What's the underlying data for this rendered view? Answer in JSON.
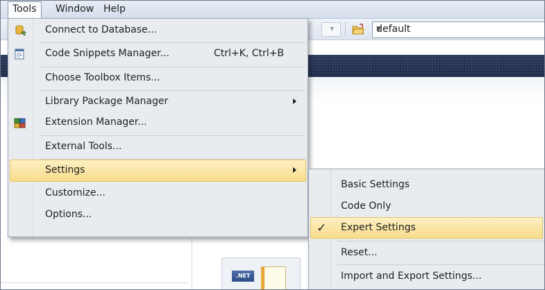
{
  "menubar": {
    "items": [
      {
        "label": "Tools"
      },
      {
        "label": "Window"
      },
      {
        "label": "Help"
      }
    ]
  },
  "toolbar": {
    "config_value": "default"
  },
  "tools_menu": {
    "items": [
      {
        "label": "Connect to Database...",
        "icon": "database-connect-icon"
      },
      {
        "label": "Code Snippets Manager...",
        "shortcut": "Ctrl+K, Ctrl+B",
        "icon": "code-snippets-icon"
      },
      {
        "label": "Choose Toolbox Items..."
      },
      {
        "label": "Library Package Manager",
        "has_submenu": true
      },
      {
        "label": "Extension Manager...",
        "icon": "extension-manager-icon"
      },
      {
        "label": "External Tools..."
      },
      {
        "label": "Settings",
        "has_submenu": true,
        "highlighted": true
      },
      {
        "label": "Customize..."
      },
      {
        "label": "Options..."
      }
    ]
  },
  "settings_submenu": {
    "items": [
      {
        "label": "Basic Settings"
      },
      {
        "label": "Code Only"
      },
      {
        "label": "Expert Settings",
        "checked": true,
        "highlighted": true
      },
      {
        "label": "Reset..."
      },
      {
        "label": "Import and Export Settings..."
      }
    ],
    "check_glyph": "✓"
  },
  "start_page": {
    "net_badge": ".NET"
  },
  "colors": {
    "highlight_top": "#fdf0c2",
    "highlight_bottom": "#f8dc8c",
    "menu_bg": "#e9ecee",
    "nav_band": "#2b3a5c"
  }
}
